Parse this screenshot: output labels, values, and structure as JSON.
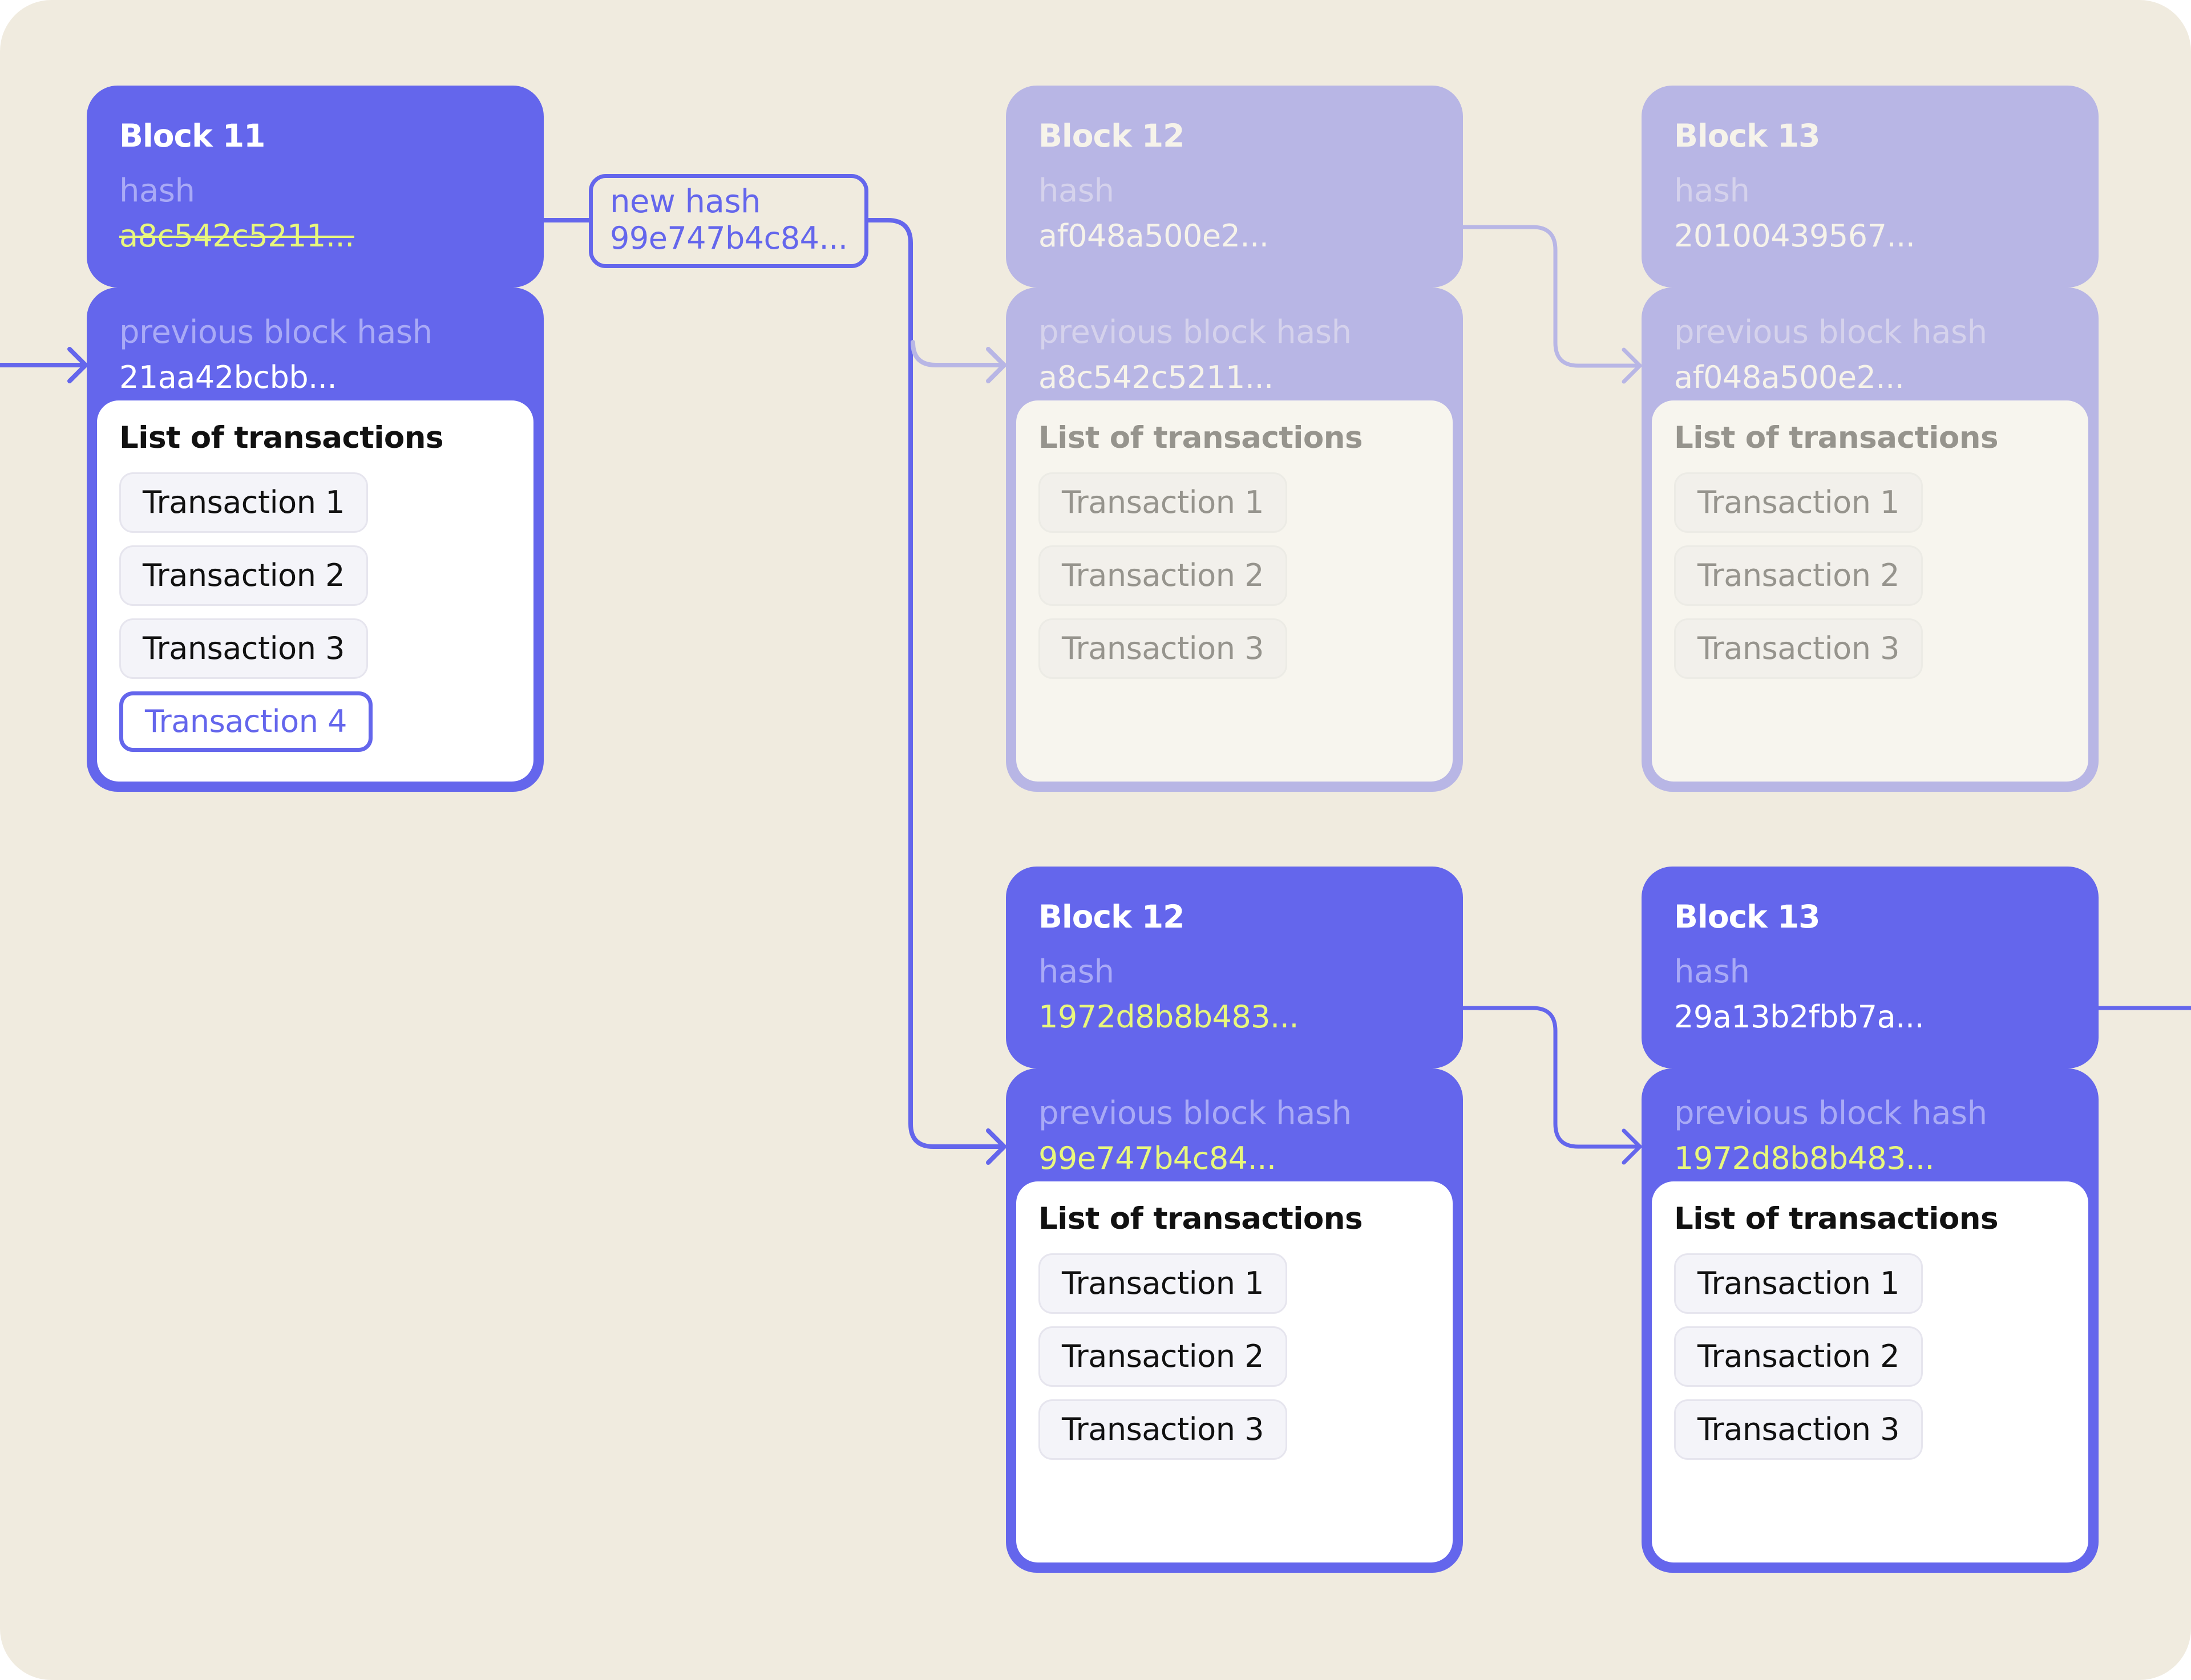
{
  "colors": {
    "background": "#f0ebdf",
    "active_block": "#6466ec",
    "faded_block": "#b8b6e5",
    "highlight_hash": "#e8f77c",
    "active_label": "#a9aaf6"
  },
  "labels": {
    "hash": "hash",
    "previous_block_hash": "previous block hash",
    "list_of_transactions": "List of transactions"
  },
  "new_hash_box": {
    "label": "new hash",
    "value": "99e747b4c84..."
  },
  "blocks": [
    {
      "id": "block-11",
      "state": "active",
      "title": "Block 11",
      "hash": "a8c542c5211...",
      "hash_struck_through": true,
      "previous_block_hash": "21aa42bcbb...",
      "transactions": [
        "Transaction 1",
        "Transaction 2",
        "Transaction 3",
        "Transaction 4"
      ],
      "new_transaction": "Transaction 4"
    },
    {
      "id": "block-12-old",
      "state": "faded",
      "title": "Block 12",
      "hash": "af048a500e2...",
      "previous_block_hash": "a8c542c5211...",
      "transactions": [
        "Transaction 1",
        "Transaction 2",
        "Transaction 3"
      ]
    },
    {
      "id": "block-13-old",
      "state": "faded",
      "title": "Block 13",
      "hash": "20100439567...",
      "previous_block_hash": "af048a500e2...",
      "transactions": [
        "Transaction 1",
        "Transaction 2",
        "Transaction 3"
      ]
    },
    {
      "id": "block-12-new",
      "state": "active",
      "title": "Block 12",
      "hash": "1972d8b8b483...",
      "hash_highlighted": true,
      "previous_block_hash": "99e747b4c84...",
      "previous_highlighted": true,
      "transactions": [
        "Transaction 1",
        "Transaction 2",
        "Transaction 3"
      ]
    },
    {
      "id": "block-13-new",
      "state": "active",
      "title": "Block 13",
      "hash": "29a13b2fbb7a...",
      "previous_block_hash": "1972d8b8b483...",
      "previous_highlighted": true,
      "transactions": [
        "Transaction 1",
        "Transaction 2",
        "Transaction 3"
      ]
    }
  ]
}
